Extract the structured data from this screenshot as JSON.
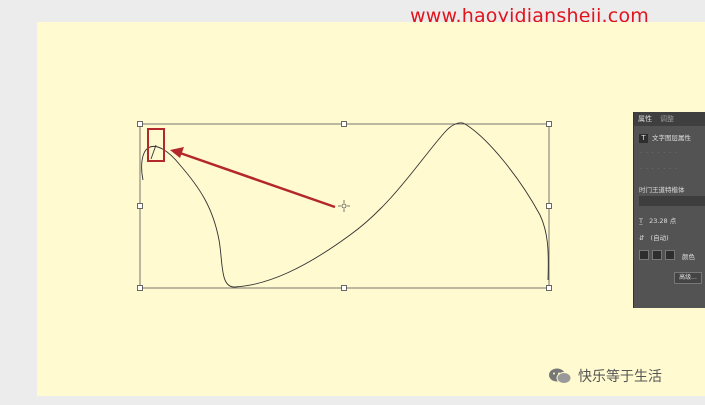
{
  "watermark": {
    "url": "www.haoyidiansheji.com",
    "wechat_text": "快乐等于生活"
  },
  "properties_panel": {
    "tab_properties": "属性",
    "tab_adjust": "调整",
    "text_layer_label": "文字图层属性",
    "font_name": "时门王道特楷体",
    "font_size": "23.28 点",
    "leading": "(自动)",
    "color_label": "颜色",
    "advanced_button": "高级..."
  },
  "colors": {
    "canvas": "#fffad0",
    "workspace": "#ececec",
    "annotation": "#b2282b",
    "panel": "#535353"
  }
}
